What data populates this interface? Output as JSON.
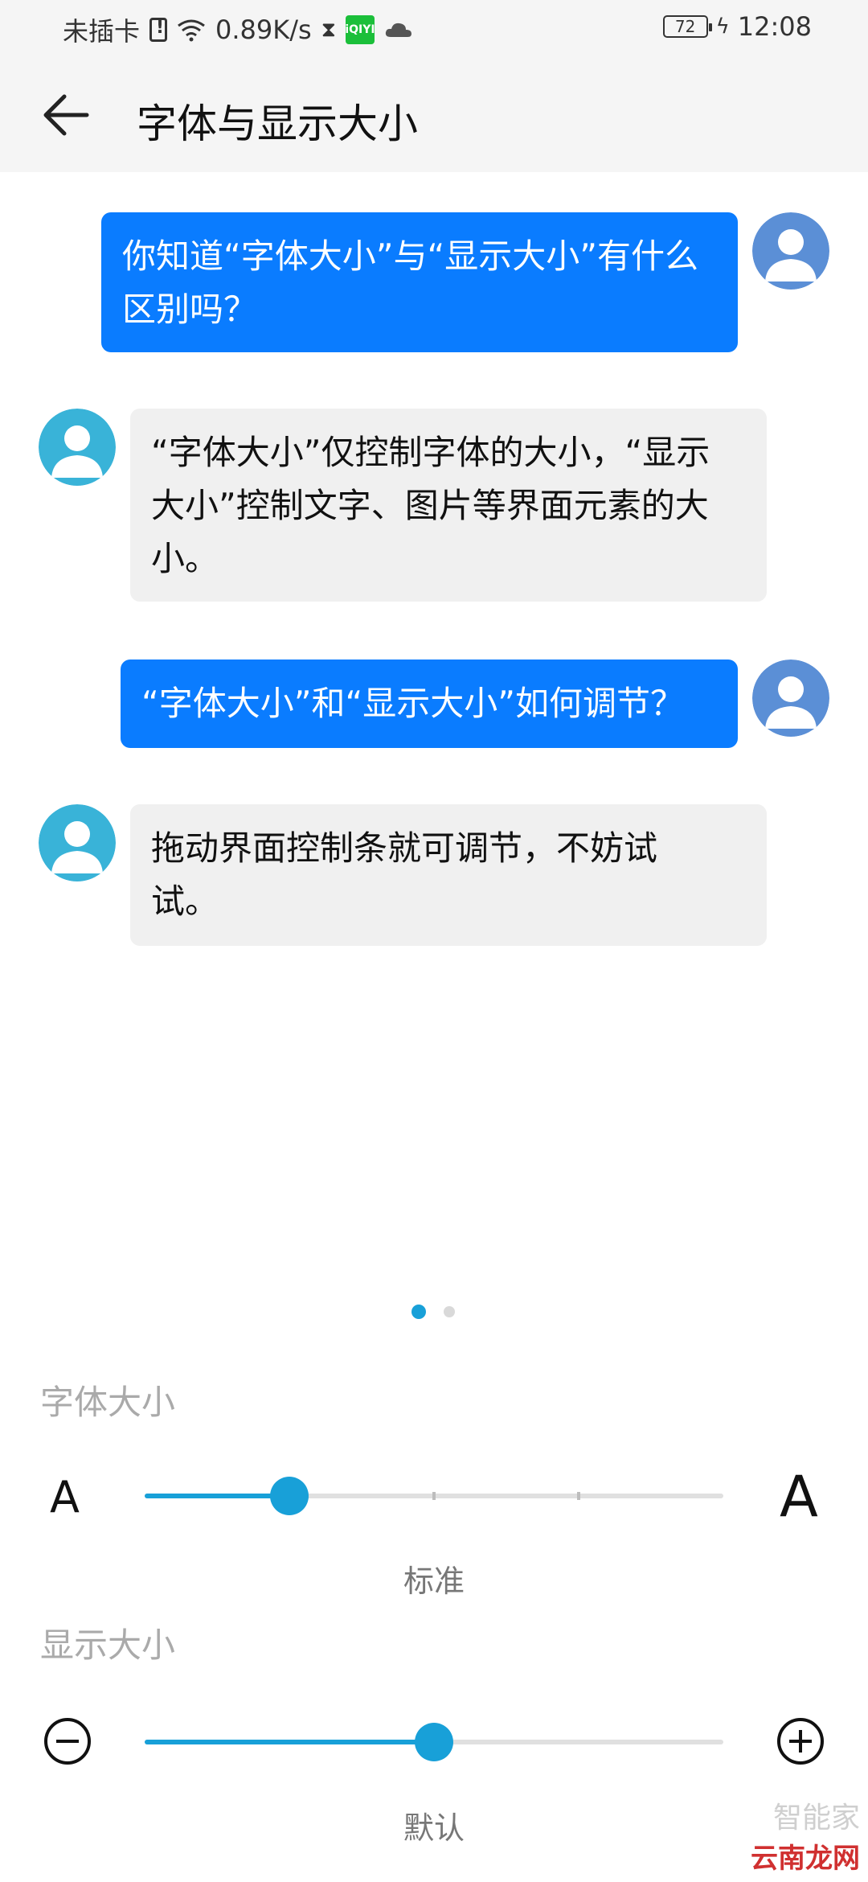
{
  "status_bar": {
    "carrier": "未插卡",
    "speed": "0.89K/s",
    "app_badge": "iQIYI",
    "battery": "72",
    "time": "12:08"
  },
  "header": {
    "title": "字体与显示大小"
  },
  "chat": [
    {
      "side": "out",
      "lines": [
        "你知道“字体大小”与“显示大小”有什么",
        "区别吗？"
      ]
    },
    {
      "side": "in",
      "lines": [
        "“字体大小”仅控制字体的大小，“显示",
        "大小”控制文字、图片等界面元素的大",
        "小。"
      ]
    },
    {
      "side": "out",
      "lines": [
        "“字体大小”和“显示大小”如何调节？"
      ]
    },
    {
      "side": "in",
      "lines": [
        "拖动界面控制条就可调节，不妨试",
        "试。"
      ]
    }
  ],
  "pager": {
    "count": 2,
    "active": 0
  },
  "font_size": {
    "label": "字体大小",
    "small_glyph": "A",
    "large_glyph": "A",
    "value_label": "标准",
    "position": 0.25,
    "steps": 4
  },
  "display_size": {
    "label": "显示大小",
    "value_label": "默认",
    "position": 0.5
  },
  "watermark": {
    "top": "智能家",
    "bottom": "云南龙网"
  },
  "colors": {
    "accent": "#18a0d8",
    "bubble_out": "#0a7cff",
    "bubble_in": "#f0f0f0",
    "avatar_out": "#5b8fd6",
    "avatar_in": "#39b3d8"
  }
}
